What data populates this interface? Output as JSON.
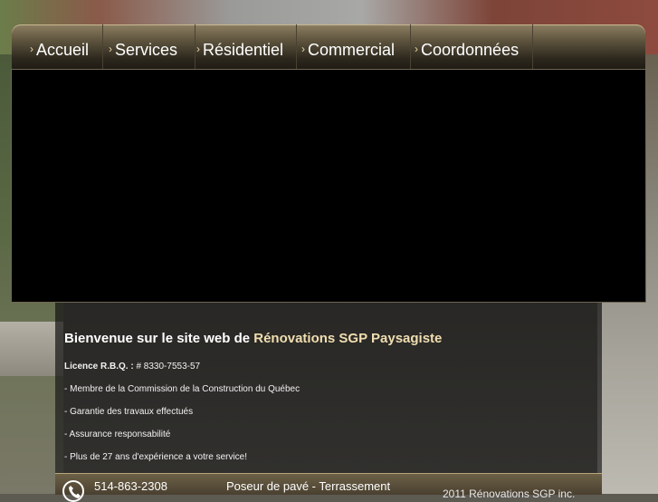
{
  "nav": {
    "items": [
      {
        "label": "Accueil"
      },
      {
        "label": "Services"
      },
      {
        "label": "Résidentiel"
      },
      {
        "label": "Commercial"
      },
      {
        "label": "Coordonnées"
      }
    ],
    "chevron_icon": "chevron-right-icon"
  },
  "content": {
    "welcome_prefix": "Bienvenue sur le site web de",
    "welcome_brand": "Rénovations SGP Paysagiste",
    "license_label": "Licence R.B.Q. :",
    "license_number": "# 8330-7553-57",
    "bullets": [
      "- Membre de la Commission de la Construction du Québec",
      "- Garantie des travaux effectués",
      "- Assurance responsabilité",
      "- Plus de 27 ans d'expérience a votre service!"
    ]
  },
  "footer": {
    "phone": "514-863-2308",
    "tagline": "Poseur de pavé - Terrassement",
    "copyright": "2011 Rénovations SGP inc.",
    "phone_icon": "phone-icon"
  },
  "colors": {
    "brand_accent": "#f0deb0",
    "nav_dark": "#1f1b14",
    "stage": "#000000"
  }
}
